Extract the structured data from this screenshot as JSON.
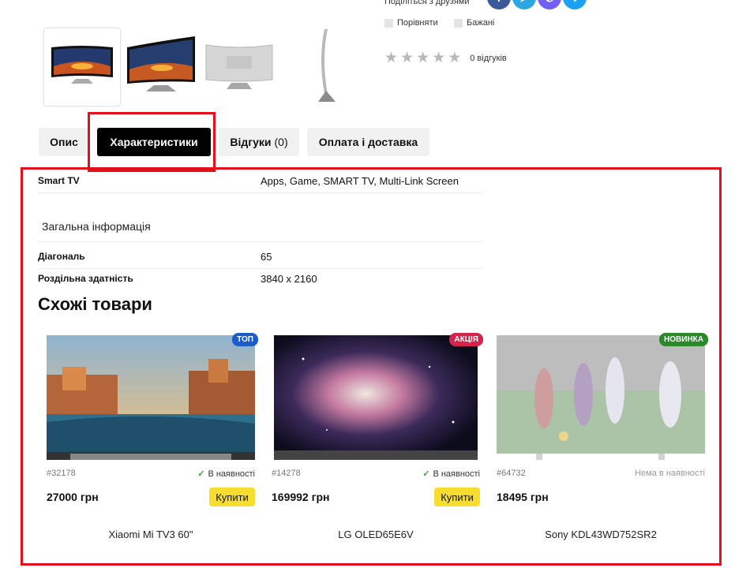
{
  "share": {
    "label": "Поділіться з друзями",
    "icons": [
      "facebook-icon",
      "telegram-icon",
      "viber-icon",
      "twitter-icon"
    ],
    "colors": [
      "#3b5998",
      "#2ca5e0",
      "#7360f2",
      "#1da1f2"
    ]
  },
  "actions": {
    "compare": "Порівняти",
    "wishlist": "Бажані"
  },
  "rating": {
    "stars": 0,
    "reviews_label": "0 відгуків"
  },
  "tabs": [
    {
      "label": "Опис"
    },
    {
      "label": "Характеристики"
    },
    {
      "label": "Відгуки",
      "count": "(0)"
    },
    {
      "label": "Оплата і доставка"
    }
  ],
  "specs": {
    "smart_tv": {
      "key": "Smart TV",
      "value": "Apps, Game, SMART TV, Multi-Link Screen"
    },
    "group_title": "Загальна інформація",
    "diagonal": {
      "key": "Діагональ",
      "value": "65"
    },
    "resolution": {
      "key": "Роздільна здатність",
      "value": "3840 x 2160"
    }
  },
  "similar": {
    "title": "Схожі товари",
    "items": [
      {
        "badge": "ТОП",
        "badge_color": "#1a5cc8",
        "sku": "#32178",
        "availability": "В наявності",
        "in_stock": true,
        "price": "27000 грн",
        "buy": "Купити",
        "name": "Xiaomi Mi TV3 60\""
      },
      {
        "badge": "АКЦІЯ",
        "badge_color": "#d6234b",
        "sku": "#14278",
        "availability": "В наявності",
        "in_stock": true,
        "price": "169992 грн",
        "buy": "Купити",
        "name": "LG OLED65E6V"
      },
      {
        "badge": "НОВИНКА",
        "badge_color": "#2a8a2a",
        "sku": "#64732",
        "availability": "Нема в наявності",
        "in_stock": false,
        "price": "18495 грн",
        "name": "Sony KDL43WD752SR2"
      }
    ]
  },
  "colors": {
    "highlight": "#e3101b",
    "buy_button": "#f7dd2f",
    "active_tab": "#000000"
  }
}
